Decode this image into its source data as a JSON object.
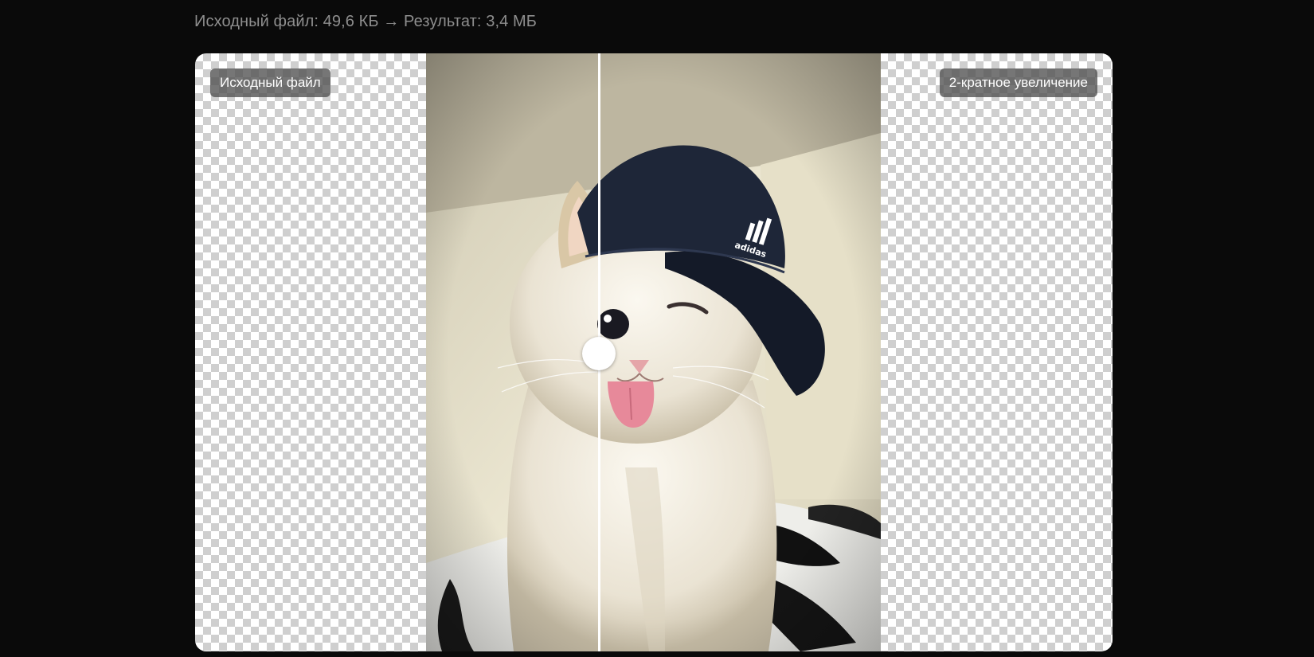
{
  "file_info": "Исходный файл: 49,6 КБ → Результат: 3,4 МБ",
  "labels": {
    "original": "Исходный файл",
    "result": "2-кратное увеличение"
  },
  "slider": {
    "position_percent": 44
  },
  "image": {
    "subject": "cat-in-cap-photo",
    "cap_logo": "adidas"
  },
  "colors": {
    "background": "#0a0a0a",
    "checker_light": "#ffffff",
    "checker_dark": "#cfcfcf",
    "badge": "#505050",
    "info_text": "#8e8e8e"
  }
}
